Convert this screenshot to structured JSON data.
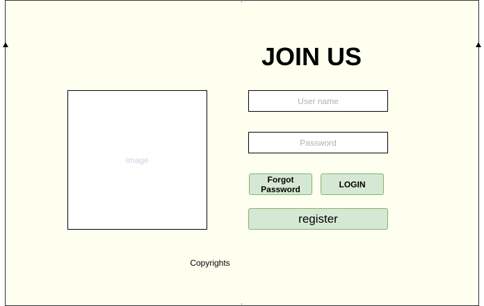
{
  "page": {
    "title": "JOIN US"
  },
  "image_placeholder": {
    "label": "image"
  },
  "form": {
    "username": {
      "placeholder": "User name",
      "value": ""
    },
    "password": {
      "placeholder": "Password",
      "value": ""
    }
  },
  "buttons": {
    "forgot_password": "Forgot\nPassword",
    "login": "LOGIN",
    "register": "register"
  },
  "footer": {
    "copyright": "Copyrights"
  },
  "colors": {
    "background": "#fffff0",
    "button_fill": "#d5e8d4",
    "button_border": "#82b366"
  }
}
